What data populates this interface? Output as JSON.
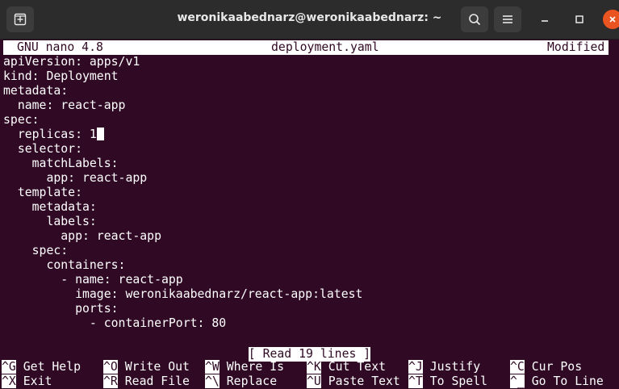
{
  "window": {
    "title": "weronikaabednarz@weronikaabednarz: ~",
    "buttons": [
      "new-tab",
      "search",
      "menu",
      "minimize",
      "maximize",
      "close"
    ]
  },
  "nano": {
    "version": "GNU nano 4.8",
    "filename": "deployment.yaml",
    "state": "Modified"
  },
  "file_lines": [
    "apiVersion: apps/v1",
    "kind: Deployment",
    "metadata:",
    "  name: react-app",
    "spec:",
    "  replicas: 1",
    "  selector:",
    "    matchLabels:",
    "      app: react-app",
    "  template:",
    "    metadata:",
    "      labels:",
    "        app: react-app",
    "    spec:",
    "      containers:",
    "        - name: react-app",
    "          image: weronikaabednarz/react-app:latest",
    "          ports:",
    "            - containerPort: 80"
  ],
  "status_message": "[ Read 19 lines ]",
  "shortcuts": [
    {
      "key": "^G",
      "label": "Get Help"
    },
    {
      "key": "^O",
      "label": "Write Out"
    },
    {
      "key": "^W",
      "label": "Where Is"
    },
    {
      "key": "^K",
      "label": "Cut Text"
    },
    {
      "key": "^J",
      "label": "Justify"
    },
    {
      "key": "^C",
      "label": "Cur Pos"
    },
    {
      "key": "^X",
      "label": "Exit"
    },
    {
      "key": "^R",
      "label": "Read File"
    },
    {
      "key": "^\\",
      "label": "Replace"
    },
    {
      "key": "^U",
      "label": "Paste Text"
    },
    {
      "key": "^T",
      "label": "To Spell"
    },
    {
      "key": "^_",
      "label": "Go To Line"
    }
  ],
  "colors": {
    "terminal_bg": "#300a24",
    "titlebar_bg": "#2c2c2c",
    "close_button": "#e95420"
  }
}
